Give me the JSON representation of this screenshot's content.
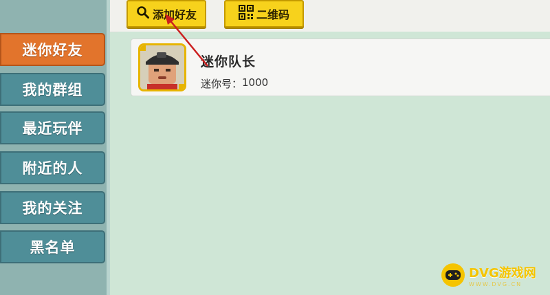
{
  "sidebar": {
    "items": [
      {
        "label": "迷你好友",
        "active": true
      },
      {
        "label": "我的群组",
        "active": false
      },
      {
        "label": "最近玩伴",
        "active": false
      },
      {
        "label": "附近的人",
        "active": false
      },
      {
        "label": "我的关注",
        "active": false
      },
      {
        "label": "黑名单",
        "active": false
      }
    ]
  },
  "toolbar": {
    "add_friend_label": "添加好友",
    "add_friend_icon": "search-icon",
    "qrcode_label": "二维码",
    "qrcode_icon": "qr-code-icon"
  },
  "friends": [
    {
      "name": "迷你队长",
      "id_label": "迷你号：",
      "id_value": "1000",
      "avatar": "avatar-captain"
    }
  ],
  "watermark": {
    "title": "DVG游戏网",
    "subtitle": "WWW.DVG.CN"
  },
  "colors": {
    "accent_active": "#e2742c",
    "nav_item": "#4f8e98",
    "button_yellow": "#f7d21c",
    "content_bg": "#cfe6d6",
    "annotation_arrow": "#cc1f1f"
  }
}
